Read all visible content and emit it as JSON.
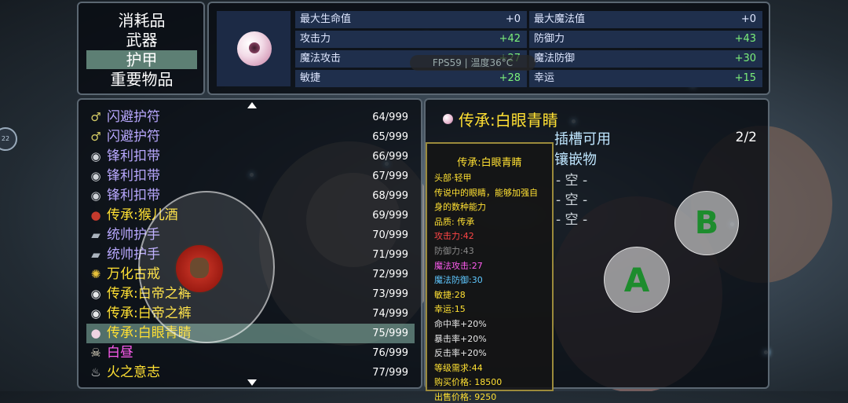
{
  "categories": [
    {
      "label": "消耗品",
      "active": false
    },
    {
      "label": "武器",
      "active": false
    },
    {
      "label": "护甲",
      "active": true
    },
    {
      "label": "重要物品",
      "active": false
    }
  ],
  "stats": {
    "left": [
      {
        "label": "最大生命值",
        "value": "+0",
        "kind": "zero"
      },
      {
        "label": "攻击力",
        "value": "+42",
        "kind": "pos"
      },
      {
        "label": "魔法攻击",
        "value": "+27",
        "kind": "pos"
      },
      {
        "label": "敏捷",
        "value": "+28",
        "kind": "pos"
      }
    ],
    "right": [
      {
        "label": "最大魔法值",
        "value": "+0",
        "kind": "zero"
      },
      {
        "label": "防御力",
        "value": "+43",
        "kind": "pos"
      },
      {
        "label": "魔法防御",
        "value": "+30",
        "kind": "pos"
      },
      {
        "label": "幸运",
        "value": "+15",
        "kind": "pos"
      }
    ]
  },
  "fps_overlay": "FPS59 | 温度36°C",
  "inventory": [
    {
      "name": "闪避护符",
      "count": "64/999",
      "color": "#b9a8ff",
      "icon": "amulet-icon",
      "glyph": "♂",
      "icon_color": "#d6cc66"
    },
    {
      "name": "闪避护符",
      "count": "65/999",
      "color": "#b9a8ff",
      "icon": "amulet-icon",
      "glyph": "♂",
      "icon_color": "#d6cc66"
    },
    {
      "name": "锋利扣带",
      "count": "66/999",
      "color": "#b9a8ff",
      "icon": "belt-icon",
      "glyph": "◉",
      "icon_color": "#cfd3d8"
    },
    {
      "name": "锋利扣带",
      "count": "67/999",
      "color": "#b9a8ff",
      "icon": "belt-icon",
      "glyph": "◉",
      "icon_color": "#cfd3d8"
    },
    {
      "name": "锋利扣带",
      "count": "68/999",
      "color": "#b9a8ff",
      "icon": "belt-icon",
      "glyph": "◉",
      "icon_color": "#cfd3d8"
    },
    {
      "name": "传承:猴儿酒",
      "count": "69/999",
      "color": "#ffe033",
      "icon": "potion-icon",
      "glyph": "●",
      "icon_color": "#c43a2d"
    },
    {
      "name": "统帅护手",
      "count": "70/999",
      "color": "#b9a8ff",
      "icon": "gauntlet-icon",
      "glyph": "▰",
      "icon_color": "#aab3bd"
    },
    {
      "name": "统帅护手",
      "count": "71/999",
      "color": "#b9a8ff",
      "icon": "gauntlet-icon",
      "glyph": "▰",
      "icon_color": "#aab3bd"
    },
    {
      "name": "万化古戒",
      "count": "72/999",
      "color": "#ffe033",
      "icon": "ring-icon",
      "glyph": "✺",
      "icon_color": "#e8c23a"
    },
    {
      "name": "传承:白帝之裤",
      "count": "73/999",
      "color": "#ffe033",
      "icon": "belt-icon",
      "glyph": "◉",
      "icon_color": "#e6e8ea"
    },
    {
      "name": "传承:白帝之裤",
      "count": "74/999",
      "color": "#ffe033",
      "icon": "belt-icon",
      "glyph": "◉",
      "icon_color": "#e6e8ea"
    },
    {
      "name": "传承:白眼青睛",
      "count": "75/999",
      "color": "#ffe033",
      "icon": "eyeball-icon",
      "glyph": "●",
      "icon_color": "#f0d4e2",
      "selected": true
    },
    {
      "name": "白昼",
      "count": "76/999",
      "color": "#ff5cf0",
      "icon": "skull-icon",
      "glyph": "☠",
      "icon_color": "#efe7d0"
    },
    {
      "name": "火之意志",
      "count": "77/999",
      "color": "#ffe033",
      "icon": "flame-icon",
      "glyph": "♨",
      "icon_color": "#e9e9e9"
    }
  ],
  "detail": {
    "title": "传承:白眼青睛",
    "socket_label": "插槽可用",
    "socket_count": "2/2",
    "gem_label": "镶嵌物",
    "empty_slots": [
      "- 空 -",
      "- 空 -",
      "- 空 -"
    ]
  },
  "tooltip": {
    "title": "传承:白眼青睛",
    "lines": [
      {
        "text": "头部·轻甲",
        "color": "#ffe033"
      },
      {
        "text": "传说中的眼睛，能够加强自",
        "color": "#ffe033"
      },
      {
        "text": "身的数种能力",
        "color": "#ffe033"
      },
      {
        "text": "品质: 传承",
        "color": "#ffe033"
      },
      {
        "text": "攻击力:42",
        "color": "#ff4545"
      },
      {
        "text": "防御力:43",
        "color": "#8a8a8a"
      },
      {
        "text": "魔法攻击:27",
        "color": "#ff5cf0"
      },
      {
        "text": "魔法防御:30",
        "color": "#5fc8ff"
      },
      {
        "text": "敏捷:28",
        "color": "#ffe033"
      },
      {
        "text": "幸运:15",
        "color": "#ffe033"
      },
      {
        "text": "命中率+20%",
        "color": "#e5e5e5"
      },
      {
        "text": "暴击率+20%",
        "color": "#e5e5e5"
      },
      {
        "text": "反击率+20%",
        "color": "#e5e5e5"
      },
      {
        "text": "等级需求:44",
        "color": "#ffe033"
      },
      {
        "text": "购买价格: 18500",
        "color": "#ffe033"
      },
      {
        "text": "出售价格: 9250",
        "color": "#ffe033"
      }
    ]
  },
  "buttons": {
    "a": "A",
    "b": "B"
  },
  "side_tab": "22"
}
